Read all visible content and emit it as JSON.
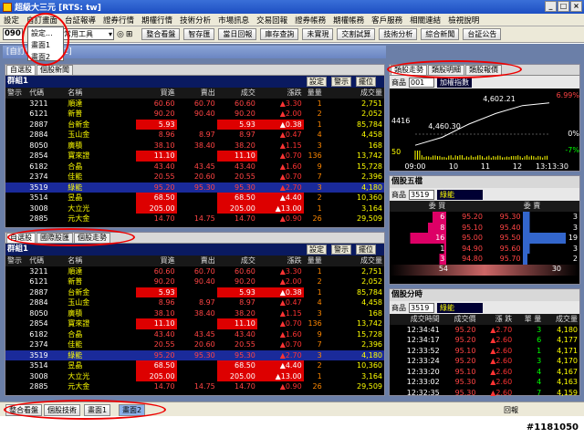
{
  "window": {
    "title": "超級大三元 [RTS: tw]"
  },
  "menu": {
    "items": [
      "設定",
      "自訂畫面",
      "台証報導",
      "證券行情",
      "期權行情",
      "技術分析",
      "市場訊息",
      "交易回報",
      "證券帳務",
      "期權帳務",
      "客戶服務",
      "相關連結",
      "檢視說明"
    ]
  },
  "dropdown": {
    "items": [
      "設定...",
      "畫面1",
      "畫面2"
    ]
  },
  "toolbar": {
    "code": "090",
    "select": "證券常用工具",
    "buttons": [
      "整合看盤",
      "智存匯",
      "當日回報",
      "庫存查詢",
      "未實現",
      "交割試算",
      "技術分析",
      "綜合新聞",
      "台証公告"
    ]
  },
  "subwindow": {
    "title": "[自訂畫面 - 畫面2]"
  },
  "top_panel": {
    "tabs": [
      "自選股",
      "個股新聞"
    ],
    "group": "群組1",
    "buttons": [
      "設定",
      "警示",
      "擺位"
    ]
  },
  "bottom_panel": {
    "tabs": [
      "自選股",
      "國際股匯",
      "個股走勢"
    ],
    "group": "群組1",
    "buttons": [
      "設定",
      "警示",
      "擺位"
    ]
  },
  "quote_headers": [
    "警示",
    "代碼",
    "名稱",
    "買進",
    "賣出",
    "成交",
    "漲跌",
    "量量",
    "成交量"
  ],
  "quotes": [
    [
      "",
      "3211",
      "順達",
      "60.60",
      "60.70",
      "60.60",
      "▲3.30",
      "1",
      "2,751"
    ],
    [
      "",
      "6121",
      "新普",
      "90.20",
      "90.40",
      "90.20",
      "▲2.00",
      "2",
      "2,052"
    ],
    [
      "",
      "2887",
      "台新金",
      "5.93",
      "",
      "5.93",
      "▲0.38",
      "1",
      "85,784"
    ],
    [
      "",
      "2884",
      "玉山金",
      "8.96",
      "8.97",
      "8.97",
      "▲0.47",
      "4",
      "4,458"
    ],
    [
      "",
      "8050",
      "廣積",
      "38.10",
      "38.40",
      "38.20",
      "▲1.15",
      "3",
      "168"
    ],
    [
      "",
      "2854",
      "寶來證",
      "11.10",
      "",
      "11.10",
      "▲0.70",
      "136",
      "13,742"
    ],
    [
      "",
      "6182",
      "合晶",
      "43.40",
      "43.45",
      "43.40",
      "▲1.60",
      "9",
      "15,728"
    ],
    [
      "",
      "2374",
      "佳能",
      "20.55",
      "20.60",
      "20.55",
      "▲0.70",
      "7",
      "2,396"
    ],
    [
      "",
      "3519",
      "綠能",
      "95.20",
      "95.30",
      "95.30",
      "▲2.70",
      "3",
      "4,180"
    ],
    [
      "",
      "3514",
      "昱晶",
      "68.50",
      "",
      "68.50",
      "▲4.40",
      "2",
      "10,360"
    ],
    [
      "",
      "3008",
      "大立光",
      "205.00",
      "",
      "205.00",
      "▲13.00",
      "1",
      "3,164"
    ],
    [
      "",
      "2885",
      "元大金",
      "14.70",
      "14.75",
      "14.70",
      "▲0.90",
      "26",
      "29,509"
    ]
  ],
  "chart_panel": {
    "tabs": [
      "類股走勢",
      "類股明細",
      "類股報價"
    ],
    "label": "商品",
    "code": "001",
    "name": "加權指數",
    "values": {
      "high": "6.99%",
      "up": "4,602.21",
      "mid": "4416",
      "low": "4,460.30",
      "zero": "0%",
      "pct": "-7%",
      "vol": "50",
      "t0": "09:00",
      "t1": "10",
      "t2": "11",
      "t3": "12",
      "t4": "13:13:30"
    }
  },
  "chart_data": {
    "type": "line",
    "x": [
      "09:00",
      "10",
      "11",
      "12",
      "13:13:30"
    ],
    "series": [
      {
        "values": [
          4440,
          4470,
          4520,
          4560,
          4590,
          4600
        ]
      }
    ]
  },
  "order_panel": {
    "title": "個股五檔",
    "label": "商品",
    "code": "3519",
    "name": "綠能",
    "buy": "委  買",
    "sell": "委  賣",
    "rows": [
      [
        "6",
        "95.20",
        "95.30",
        "3"
      ],
      [
        "8",
        "95.10",
        "95.40",
        "3"
      ],
      [
        "16",
        "95.00",
        "95.50",
        "19"
      ],
      [
        "1",
        "94.90",
        "95.60",
        "3"
      ],
      [
        "3",
        "94.80",
        "95.70",
        "2"
      ]
    ],
    "total_buy": "54",
    "total_sell": "30"
  },
  "tick_panel": {
    "title": "個股分時",
    "label": "商品",
    "code": "3519",
    "name": "綠能",
    "headers": [
      "成交時間",
      "成交價",
      "漲 跌",
      "單 量",
      "成交量"
    ],
    "rows": [
      [
        "12:34:41",
        "95.20",
        "▲2.70",
        "3",
        "4,180"
      ],
      [
        "12:34:17",
        "95.20",
        "▲2.60",
        "6",
        "4,177"
      ],
      [
        "12:33:52",
        "95.10",
        "▲2.60",
        "1",
        "4,171"
      ],
      [
        "12:33:24",
        "95.20",
        "▲2.60",
        "3",
        "4,170"
      ],
      [
        "12:33:20",
        "95.10",
        "▲2.60",
        "4",
        "4,167"
      ],
      [
        "12:33:02",
        "95.30",
        "▲2.60",
        "4",
        "4,163"
      ],
      [
        "12:32:35",
        "95.30",
        "▲2.60",
        "7",
        "4,159"
      ]
    ]
  },
  "bottom_tabs": [
    "整合看盤",
    "個股技術",
    "畫面1",
    "畫面2"
  ],
  "status": {
    "right": "回報"
  },
  "watermark": "#1181050"
}
